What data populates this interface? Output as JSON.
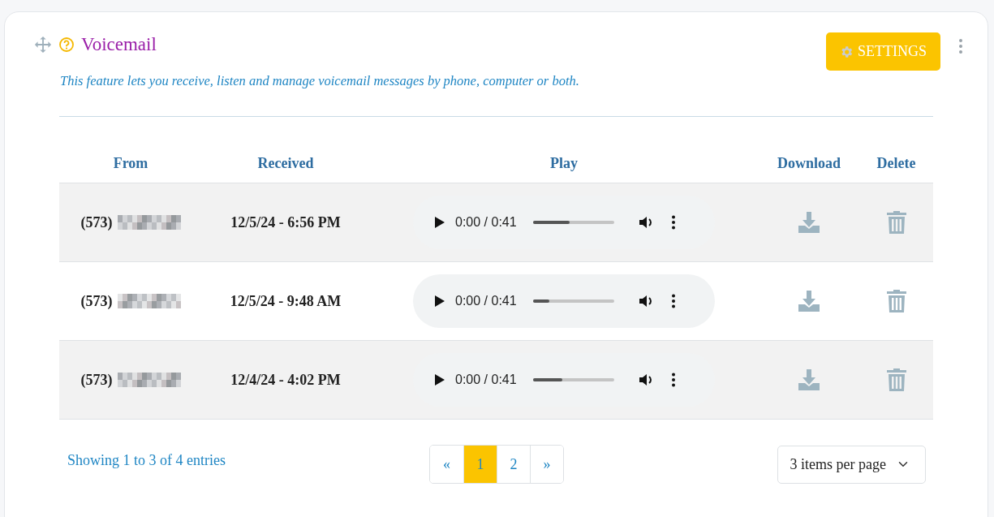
{
  "card": {
    "title": "Voicemail",
    "description": "This feature lets you receive, listen and manage voicemail messages by phone, computer or both.",
    "settings_button": "SETTINGS"
  },
  "table": {
    "columns": [
      "From",
      "Received",
      "Play",
      "Download",
      "Delete"
    ],
    "rows": [
      {
        "from": "(573)",
        "received": "12/5/24 - 6:56 PM",
        "time": "0:00 / 0:41",
        "level": 0.45
      },
      {
        "from": "(573)",
        "received": "12/5/24 - 9:48 AM",
        "time": "0:00 / 0:41",
        "level": 0.2
      },
      {
        "from": "(573)",
        "received": "12/4/24 - 4:02 PM",
        "time": "0:00 / 0:41",
        "level": 0.36
      }
    ]
  },
  "footer": {
    "summary": "Showing 1 to 3 of 4 entries",
    "pages": [
      {
        "label": "«",
        "selected": false
      },
      {
        "label": "1",
        "selected": true
      },
      {
        "label": "2",
        "selected": false
      },
      {
        "label": "»",
        "selected": false
      }
    ],
    "page_size": "3 items per page"
  }
}
